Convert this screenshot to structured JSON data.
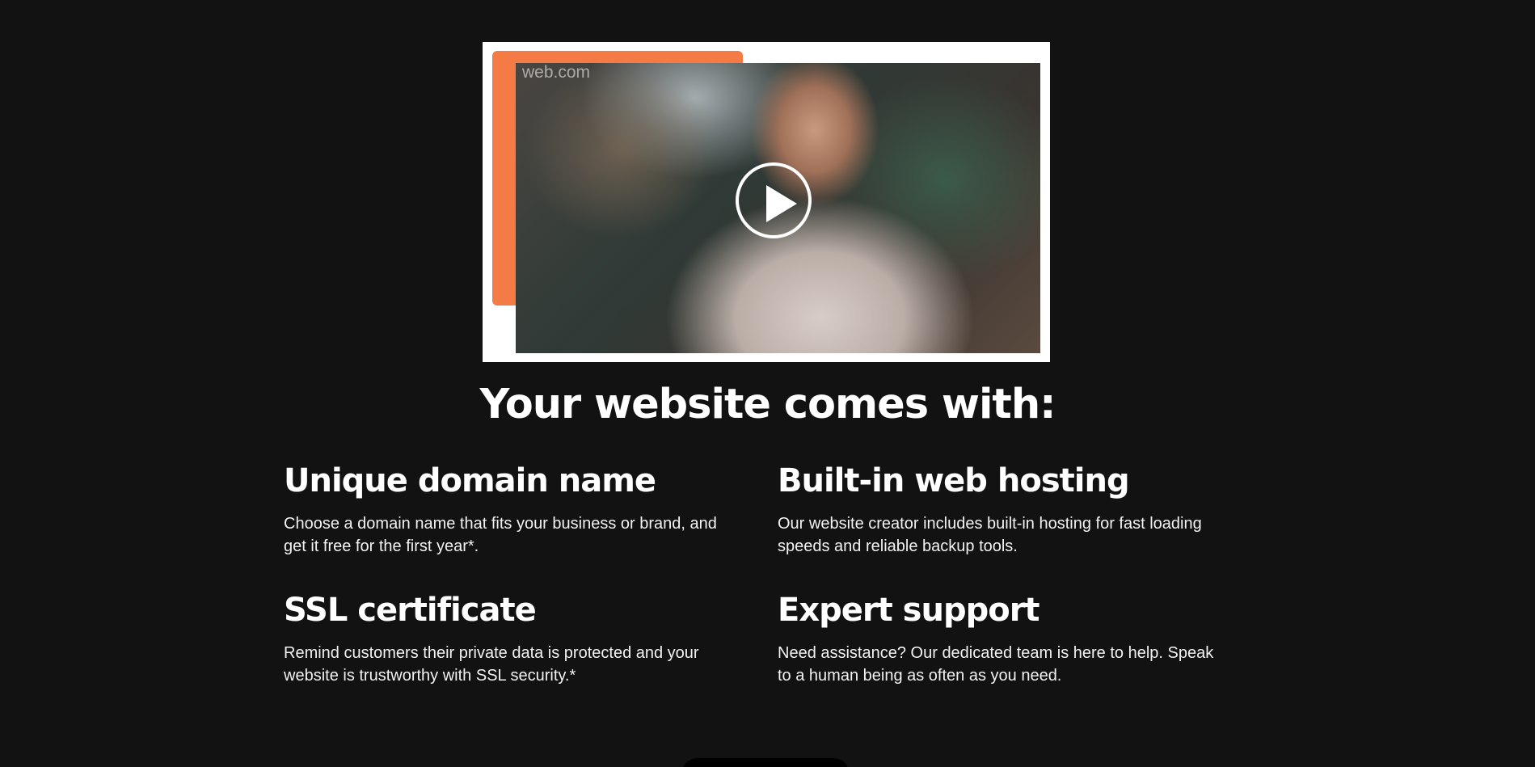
{
  "video": {
    "watermark": "web.com",
    "accent_color": "#f47b45",
    "play_icon": "play-icon"
  },
  "section": {
    "title": "Your website comes with:"
  },
  "features": [
    {
      "title": "Unique domain name",
      "description": "Choose a domain name that fits your business or brand, and get it free for the first year*."
    },
    {
      "title": "Built-in web hosting",
      "description": "Our website creator includes built-in hosting for fast loading speeds and reliable backup tools."
    },
    {
      "title": "SSL certificate",
      "description": "Remind customers their private data is protected and your website is trustworthy with SSL security.*"
    },
    {
      "title": "Expert support",
      "description": "Need assistance? Our dedicated team is here to help. Speak to a human being as often as you need."
    }
  ],
  "colors": {
    "background": "#121212",
    "text": "#ffffff",
    "accent": "#f47b45"
  }
}
